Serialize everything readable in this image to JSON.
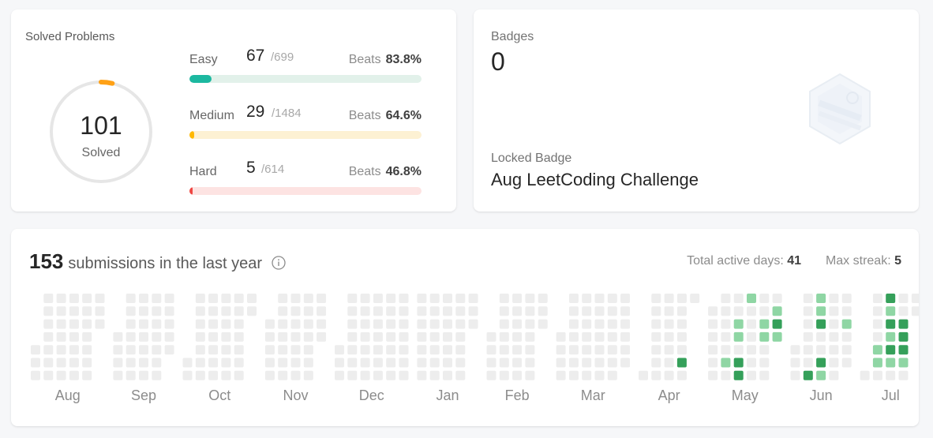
{
  "solved": {
    "title": "Solved Problems",
    "total": "101",
    "total_label": "Solved",
    "progress_fraction": 0.0365,
    "difficulties": [
      {
        "name": "Easy",
        "count": "67",
        "total": "/699",
        "beats_label": "Beats",
        "beats": "83.8%",
        "fraction": 0.0959,
        "color": "#1cb8a0",
        "track": "#e2f1ea"
      },
      {
        "name": "Medium",
        "count": "29",
        "total": "/1484",
        "beats_label": "Beats",
        "beats": "64.6%",
        "fraction": 0.0195,
        "color": "#ffb800",
        "track": "#fdf1d3"
      },
      {
        "name": "Hard",
        "count": "5",
        "total": "/614",
        "beats_label": "Beats",
        "beats": "46.8%",
        "fraction": 0.0081,
        "color": "#ef4743",
        "track": "#fde3e2"
      }
    ]
  },
  "badges": {
    "label": "Badges",
    "count": "0",
    "locked_label": "Locked Badge",
    "locked_name": "Aug LeetCoding Challenge"
  },
  "submissions": {
    "count": "153",
    "text": "submissions in the last year",
    "active_days_label": "Total active days:",
    "active_days": "41",
    "max_streak_label": "Max streak:",
    "max_streak": "5",
    "months": [
      "Aug",
      "Sep",
      "Oct",
      "Nov",
      "Dec",
      "Jan",
      "Feb",
      "Mar",
      "Apr",
      "May",
      "Jun",
      "Jul"
    ],
    "colors": {
      "empty": "#ededed",
      "light": "#8fd6a4",
      "medium": "#35a05a",
      "dark": "#196c2e"
    },
    "active_cells": [
      {
        "week": 47,
        "day": 5,
        "level": 2
      },
      {
        "week": 48,
        "day": 1,
        "level": 2
      },
      {
        "week": 50,
        "day": 5,
        "level": 1
      },
      {
        "week": 52,
        "day": 0,
        "level": 1
      },
      {
        "week": 51,
        "day": 2,
        "level": 1
      },
      {
        "week": 51,
        "day": 3,
        "level": 1
      },
      {
        "week": 51,
        "day": 5,
        "level": 2
      },
      {
        "week": 51,
        "day": 6,
        "level": 2
      },
      {
        "week": 53,
        "day": 2,
        "level": 1
      },
      {
        "week": 53,
        "day": 3,
        "level": 1
      },
      {
        "week": 54,
        "day": 1,
        "level": 1
      },
      {
        "week": 54,
        "day": 2,
        "level": 2
      },
      {
        "week": 54,
        "day": 3,
        "level": 1
      },
      {
        "week": 54,
        "day": 4,
        "level": 2
      },
      {
        "week": 54,
        "day": 5,
        "level": 2
      },
      {
        "week": 54,
        "day": 6,
        "level": 2
      },
      {
        "week": 55,
        "day": 3,
        "level": 1
      },
      {
        "week": 56,
        "day": 6,
        "level": 2
      },
      {
        "week": 57,
        "day": 0,
        "level": 1
      },
      {
        "week": 57,
        "day": 1,
        "level": 1
      },
      {
        "week": 57,
        "day": 2,
        "level": 2
      },
      {
        "week": 57,
        "day": 5,
        "level": 2
      },
      {
        "week": 57,
        "day": 6,
        "level": 1
      },
      {
        "week": 59,
        "day": 2,
        "level": 1
      },
      {
        "week": 60,
        "day": 1,
        "level": 1
      },
      {
        "week": 60,
        "day": 3,
        "level": 2
      },
      {
        "week": 60,
        "day": 4,
        "level": 1
      },
      {
        "week": 60,
        "day": 5,
        "level": 2
      },
      {
        "week": 61,
        "day": 4,
        "level": 1
      },
      {
        "week": 61,
        "day": 5,
        "level": 1
      },
      {
        "week": 62,
        "day": 0,
        "level": 2
      },
      {
        "week": 62,
        "day": 1,
        "level": 1
      },
      {
        "week": 62,
        "day": 2,
        "level": 2
      },
      {
        "week": 62,
        "day": 3,
        "level": 1
      },
      {
        "week": 62,
        "day": 4,
        "level": 2
      },
      {
        "week": 62,
        "day": 5,
        "level": 1
      },
      {
        "week": 63,
        "day": 2,
        "level": 2
      },
      {
        "week": 63,
        "day": 3,
        "level": 2
      },
      {
        "week": 63,
        "day": 4,
        "level": 2
      },
      {
        "week": 63,
        "day": 5,
        "level": 1
      }
    ]
  }
}
